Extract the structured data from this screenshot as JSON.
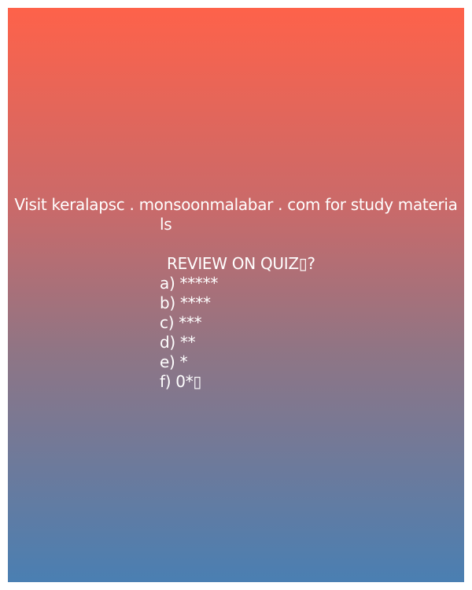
{
  "promo": {
    "line1": "Visit keralapsc . monsoonmalabar . com for study materia",
    "line2": "ls"
  },
  "quiz": {
    "title": "REVIEW ON QUIZ▯?",
    "options": [
      "a) *****",
      "b) ****",
      "c) ***",
      "d) **",
      "e) *",
      "f) 0*▯"
    ]
  }
}
